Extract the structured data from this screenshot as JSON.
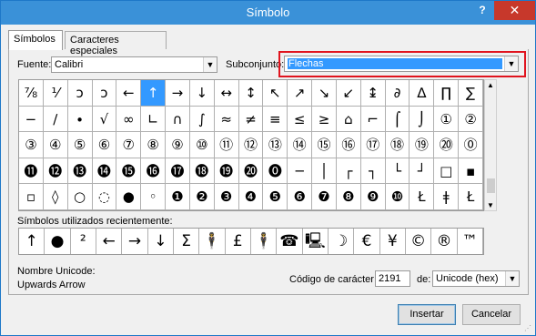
{
  "window": {
    "title": "Símbolo",
    "help_label": "?",
    "close_label": "✕"
  },
  "tabs": [
    {
      "label": "Símbolos",
      "active": true
    },
    {
      "label": "Caracteres especiales",
      "active": false
    }
  ],
  "font": {
    "label": "Fuente:",
    "value": "Calibri"
  },
  "subset": {
    "label": "Subconjunto:",
    "value": "Flechas"
  },
  "symbol_grid": {
    "rows": [
      [
        "⅞",
        "⅟",
        "ↄ",
        "ↄ",
        "←",
        "↑",
        "→",
        "↓",
        "↔",
        "↕",
        "↖",
        "↗",
        "↘",
        "↙",
        "↨",
        "∂",
        "∆",
        "∏",
        "∑"
      ],
      [
        "−",
        "∕",
        "∙",
        "√",
        "∞",
        "∟",
        "∩",
        "∫",
        "≈",
        "≠",
        "≡",
        "≤",
        "≥",
        "⌂",
        "⌐",
        "⌠",
        "⌡",
        "①",
        "②"
      ],
      [
        "③",
        "④",
        "⑤",
        "⑥",
        "⑦",
        "⑧",
        "⑨",
        "⑩",
        "⑪",
        "⑫",
        "⑬",
        "⑭",
        "⑮",
        "⑯",
        "⑰",
        "⑱",
        "⑲",
        "⑳",
        "⓪"
      ],
      [
        "⓫",
        "⓬",
        "⓭",
        "⓮",
        "⓯",
        "⓰",
        "⓱",
        "⓲",
        "⓳",
        "⓴",
        "⓿",
        "─",
        "│",
        "┌",
        "┐",
        "└",
        "┘",
        "□",
        "▪"
      ],
      [
        "▫",
        "◊",
        "○",
        "◌",
        "●",
        "◦",
        "❶",
        "❷",
        "❸",
        "❹",
        "❺",
        "❻",
        "❼",
        "❽",
        "❾",
        "❿",
        "Ł",
        "ǂ",
        "Ł"
      ]
    ],
    "selected": {
      "row": 0,
      "col": 5
    }
  },
  "recent": {
    "label": "Símbolos utilizados recientemente:",
    "symbols": [
      "↑",
      "●",
      "²",
      "←",
      "→",
      "↓",
      "Σ",
      "🕴",
      "£",
      "🕴",
      "☎",
      "🖳",
      "☽",
      "€",
      "¥",
      "©",
      "®",
      "™"
    ]
  },
  "unicode_name": {
    "label": "Nombre Unicode:",
    "value": "Upwards Arrow"
  },
  "char_code": {
    "label": "Código de carácter:",
    "value": "2191"
  },
  "from": {
    "label": "de:",
    "value": "Unicode (hex)"
  },
  "buttons": {
    "insert": "Insertar",
    "cancel": "Cancelar"
  }
}
